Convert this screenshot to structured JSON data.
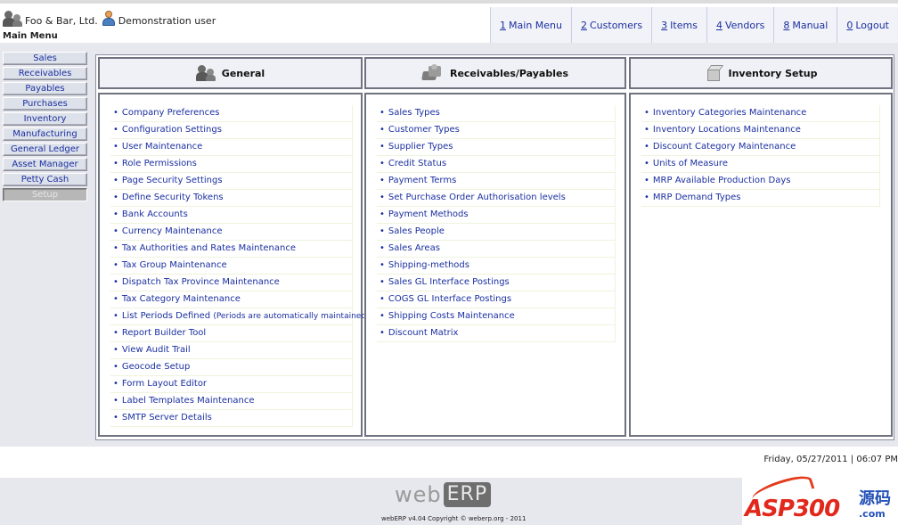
{
  "header": {
    "company": "Foo & Bar, Ltd.",
    "user": "Demonstration user",
    "page_title": "Main Menu",
    "nav": [
      {
        "key": "1",
        "label": "Main Menu"
      },
      {
        "key": "2",
        "label": "Customers"
      },
      {
        "key": "3",
        "label": "Items"
      },
      {
        "key": "4",
        "label": "Vendors"
      },
      {
        "key": "8",
        "label": "Manual"
      },
      {
        "key": "0",
        "label": "Logout"
      }
    ]
  },
  "sidebar": {
    "items": [
      {
        "label": "Sales"
      },
      {
        "label": "Receivables"
      },
      {
        "label": "Payables"
      },
      {
        "label": "Purchases"
      },
      {
        "label": "Inventory"
      },
      {
        "label": "Manufacturing"
      },
      {
        "label": "General Ledger"
      },
      {
        "label": "Asset Manager"
      },
      {
        "label": "Petty Cash"
      },
      {
        "label": "Setup",
        "active": true
      }
    ]
  },
  "sections": [
    {
      "title": "General",
      "icon": "people-icon",
      "links": [
        "Company Preferences",
        "Configuration Settings",
        "User Maintenance",
        "Role Permissions",
        "Page Security Settings",
        "Define Security Tokens",
        "Bank Accounts",
        "Currency Maintenance",
        "Tax Authorities and Rates Maintenance",
        "Tax Group Maintenance",
        "Dispatch Tax Province Maintenance",
        "Tax Category Maintenance",
        "List Periods Defined",
        "Report Builder Tool",
        "View Audit Trail",
        "Geocode Setup",
        "Form Layout Editor",
        "Label Templates Maintenance",
        "SMTP Server Details"
      ],
      "periods_note": "(Periods are automatically maintained)"
    },
    {
      "title": "Receivables/Payables",
      "icon": "money-icon",
      "links": [
        "Sales Types",
        "Customer Types",
        "Supplier Types",
        "Credit Status",
        "Payment Terms",
        "Set Purchase Order Authorisation levels",
        "Payment Methods",
        "Sales People",
        "Sales Areas",
        "Shipping-methods",
        "Sales GL Interface Postings",
        "COGS GL Interface Postings",
        "Shipping Costs Maintenance",
        "Discount Matrix"
      ]
    },
    {
      "title": "Inventory Setup",
      "icon": "box-icon",
      "links": [
        "Inventory Categories Maintenance",
        "Inventory Locations Maintenance",
        "Discount Category Maintenance",
        "Units of Measure",
        "MRP Available Production Days",
        "MRP Demand Types"
      ]
    }
  ],
  "footer": {
    "datetime": "Friday, 05/27/2011 | 06:07 PM",
    "logo_web": "web",
    "logo_erp": "ERP",
    "copyright": "webERP v4.04 Copyright © weberp.org - 2011"
  },
  "watermark": {
    "text": "ASP300",
    "cn": "源码",
    "domain": ".com"
  },
  "colors": {
    "link": "#1a2fa0",
    "panel_bg": "#e7e7ee",
    "border": "#6f7380"
  }
}
